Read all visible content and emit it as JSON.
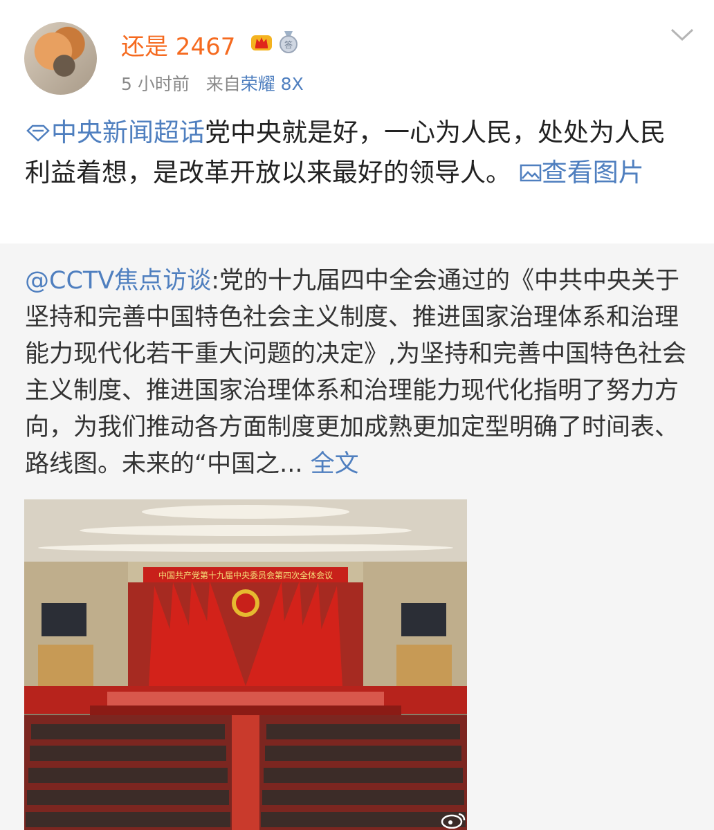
{
  "post": {
    "username": "还是 2467",
    "time": "5 小时前",
    "from_label": "来自",
    "device": "荣耀 8X",
    "topic": "中央新闻超话",
    "text": "党中央就是好，一心为人民，处处为人民利益着想，是改革开放以来最好的领导人。",
    "view_images": "查看图片"
  },
  "repost": {
    "mention": "@CCTV焦点访谈",
    "text": ":党的十九届四中全会通过的《中共中央关于坚持和完善中国特色社会主义制度、推进国家治理体系和治理能力现代化若干重大问题的决定》,为坚持和完善中国特色社会主义制度、推进国家治理体系和治理能力现代化指明了努力方向，为我们推动各方面制度更加成熟更加定型明确了时间表、路线图。未来的“中国之...",
    "fulltext": "全文",
    "banner": "中国共产党第十九届中央委员会第四次全体会议"
  },
  "colors": {
    "username": "#f56a1f",
    "link": "#4f7fbf",
    "repost_bg": "#f5f5f5"
  },
  "icons": [
    "crown-icon",
    "medal-icon",
    "chevron-down-icon",
    "topic-diamond-icon",
    "image-icon",
    "weibo-watermark-icon"
  ]
}
